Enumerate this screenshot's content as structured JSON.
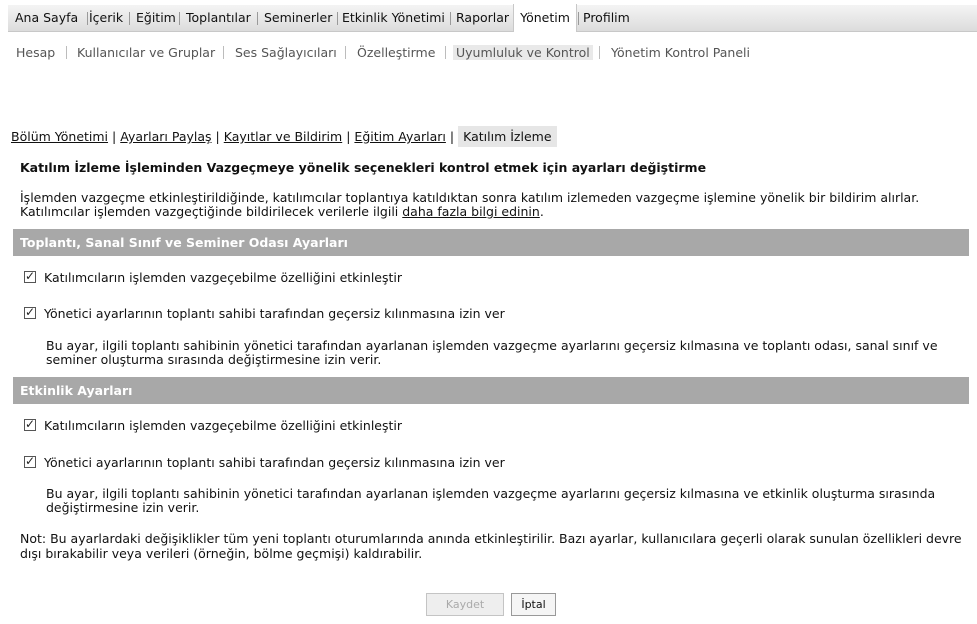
{
  "top_nav": {
    "items": [
      "Ana Sayfa",
      "İçerik",
      "Eğitim",
      "Toplantılar",
      "Seminerler",
      "Etkinlik Yönetimi",
      "Raporlar",
      "Yönetim",
      "Profilim"
    ],
    "active": "Yönetim"
  },
  "sub_nav": {
    "items": [
      "Hesap",
      "Kullanıcılar ve Gruplar",
      "Ses Sağlayıcıları",
      "Özelleştirme",
      "Uyumluluk ve Kontrol",
      "Yönetim Kontrol Paneli"
    ],
    "active": "Uyumluluk ve Kontrol"
  },
  "tabs": {
    "items": [
      "Bölüm Yönetimi",
      "Ayarları Paylaş",
      "Kayıtlar ve Bildirim",
      "Eğitim Ayarları"
    ],
    "active": "Katılım İzleme"
  },
  "page": {
    "title": "Katılım İzleme İşleminden Vazgeçmeye yönelik seçenekleri kontrol etmek için ayarları değiştirme",
    "description_pre": "İşlemden vazgeçme etkinleştirildiğinde, katılımcılar toplantıya katıldıktan sonra katılım izlemeden vazgeçme işlemine yönelik bir bildirim alırlar. Katılımcılar işlemden vazgeçtiğinde bildirilecek verilerle ilgili ",
    "description_link": "daha fazla bilgi edinin",
    "description_post": "."
  },
  "meeting_section": {
    "header": "Toplantı, Sanal Sınıf ve Seminer Odası Ayarları",
    "option1": "Katılımcıların işlemden vazgeçebilme özelliğini etkinleştir",
    "option1_checked": true,
    "option2": "Yönetici ayarlarının toplantı sahibi tarafından geçersiz kılınmasına izin ver",
    "option2_checked": true,
    "help": "Bu ayar, ilgili toplantı sahibinin yönetici tarafından ayarlanan işlemden vazgeçme ayarlarını geçersiz kılmasına ve toplantı odası, sanal sınıf ve seminer oluşturma sırasında değiştirmesine izin verir."
  },
  "event_section": {
    "header": "Etkinlik Ayarları",
    "option1": "Katılımcıların işlemden vazgeçebilme özelliğini etkinleştir",
    "option1_checked": true,
    "option2": "Yönetici ayarlarının toplantı sahibi tarafından geçersiz kılınmasına izin ver",
    "option2_checked": true,
    "help": "Bu ayar, ilgili toplantı sahibinin yönetici tarafından ayarlanan işlemden vazgeçme ayarlarını geçersiz kılmasına ve etkinlik oluşturma sırasında değiştirmesine izin verir."
  },
  "note": "Not: Bu ayarlardaki değişiklikler tüm yeni toplantı oturumlarında anında etkinleştirilir. Bazı ayarlar, kullanıcılara geçerli olarak sunulan özellikleri devre dışı bırakabilir veya verileri (örneğin, bölme geçmişi) kaldırabilir.",
  "buttons": {
    "save": "Kaydet",
    "cancel": "İptal"
  },
  "colors": {
    "section_bg": "#a8a8a8",
    "nav_bg": "#e6e6e6"
  }
}
